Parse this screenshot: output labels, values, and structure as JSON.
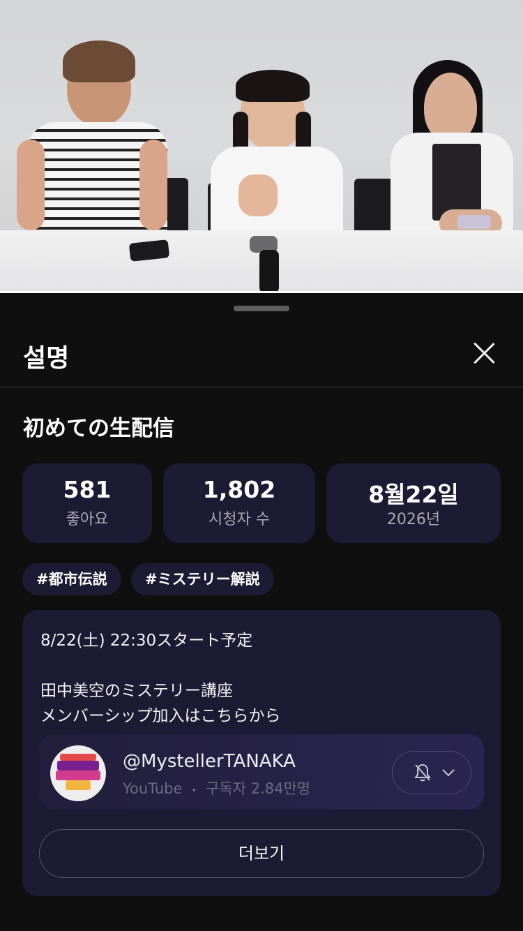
{
  "sheet": {
    "header_title": "설명",
    "video_title": "初めての生配信"
  },
  "stats": [
    {
      "value": "581",
      "label": "좋아요"
    },
    {
      "value": "1,802",
      "label": "시청자 수"
    },
    {
      "value": "8월22일",
      "label": "2026년"
    }
  ],
  "tags": [
    "#都市伝説",
    "#ミステリー解説"
  ],
  "description": {
    "lines": [
      "8/22(土) 22:30スタート予定",
      "田中美空のミステリー講座",
      "メンバーシップ加入はこちらから"
    ]
  },
  "channel": {
    "handle": "@MystellerTANAKA",
    "platform": "YouTube",
    "separator": "•",
    "subscribers": "구독자 2.84만명"
  },
  "more_button": "더보기"
}
